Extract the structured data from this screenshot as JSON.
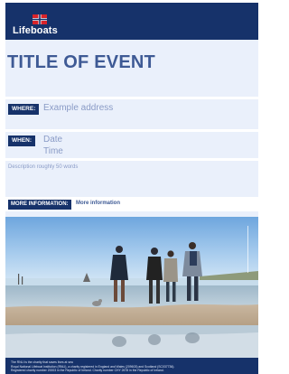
{
  "brand": {
    "name": "Lifeboats",
    "colors": {
      "navy": "#16326a",
      "title_blue": "#3e5a95",
      "panel": "#eaf0fb",
      "flag_red": "#d8232a"
    }
  },
  "event": {
    "title": "TITLE OF EVENT",
    "where_label": "WHERE:",
    "where_value": "Example address",
    "when_label": "WHEN:",
    "date_value": "Date",
    "time_value": "Time",
    "description": "Description roughly 50 words",
    "more_label": "MORE INFORMATION:",
    "more_value": "More information"
  },
  "photo": {
    "subject": "four people walking on a beach"
  },
  "footer": {
    "line1": "The RNLI is the charity that saves lives at sea",
    "line2": "Royal National Lifeboat Institution (RNLI), a charity registered in England and Wales (209603) and Scotland (SC037736).",
    "line3": "Registered charity number 20003 in the Republic of Ireland. Charity number CHY 2678 in the Republic of Ireland."
  }
}
